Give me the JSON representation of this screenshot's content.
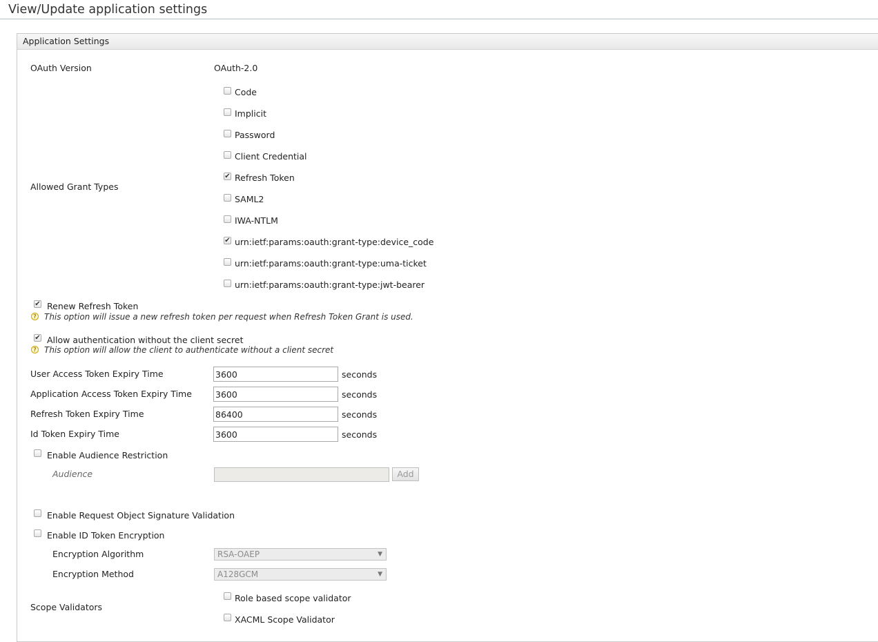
{
  "page": {
    "title": "View/Update application settings"
  },
  "panel": {
    "header": "Application Settings"
  },
  "oauth_version": {
    "label": "OAuth Version",
    "value": "OAuth-2.0"
  },
  "grant_types": {
    "label": "Allowed Grant Types",
    "items": [
      {
        "label": "Code",
        "checked": false
      },
      {
        "label": "Implicit",
        "checked": false
      },
      {
        "label": "Password",
        "checked": false
      },
      {
        "label": "Client Credential",
        "checked": false
      },
      {
        "label": "Refresh Token",
        "checked": true
      },
      {
        "label": "SAML2",
        "checked": false
      },
      {
        "label": "IWA-NTLM",
        "checked": false
      },
      {
        "label": "urn:ietf:params:oauth:grant-type:device_code",
        "checked": true
      },
      {
        "label": "urn:ietf:params:oauth:grant-type:uma-ticket",
        "checked": false
      },
      {
        "label": "urn:ietf:params:oauth:grant-type:jwt-bearer",
        "checked": false
      }
    ]
  },
  "renew_refresh": {
    "label": "Renew Refresh Token",
    "checked": true,
    "hint": "This option will issue a new refresh token per request when Refresh Token Grant is used."
  },
  "allow_no_secret": {
    "label": "Allow authentication without the client secret",
    "checked": true,
    "hint": "This option will allow the client to authenticate without a client secret"
  },
  "expiry": {
    "unit": "seconds",
    "fields": [
      {
        "label": "User Access Token Expiry Time",
        "value": "3600"
      },
      {
        "label": "Application Access Token Expiry Time",
        "value": "3600"
      },
      {
        "label": "Refresh Token Expiry Time",
        "value": "86400"
      },
      {
        "label": "Id Token Expiry Time",
        "value": "3600"
      }
    ]
  },
  "audience": {
    "enable_label": "Enable Audience Restriction",
    "enabled": false,
    "field_label": "Audience",
    "value": "",
    "add_label": "Add"
  },
  "request_object": {
    "label": "Enable Request Object Signature Validation",
    "checked": false
  },
  "id_token_encryption": {
    "label": "Enable ID Token Encryption",
    "checked": false,
    "algorithm_label": "Encryption Algorithm",
    "algorithm_value": "RSA-OAEP",
    "method_label": "Encryption Method",
    "method_value": "A128GCM"
  },
  "scope_validators": {
    "label": "Scope Validators",
    "items": [
      {
        "label": "Role based scope validator",
        "checked": false
      },
      {
        "label": "XACML Scope Validator",
        "checked": false
      }
    ]
  },
  "icons": {
    "help": "question-mark-help-icon",
    "dropdown": "triangle-down-icon",
    "check": "check-mark"
  }
}
